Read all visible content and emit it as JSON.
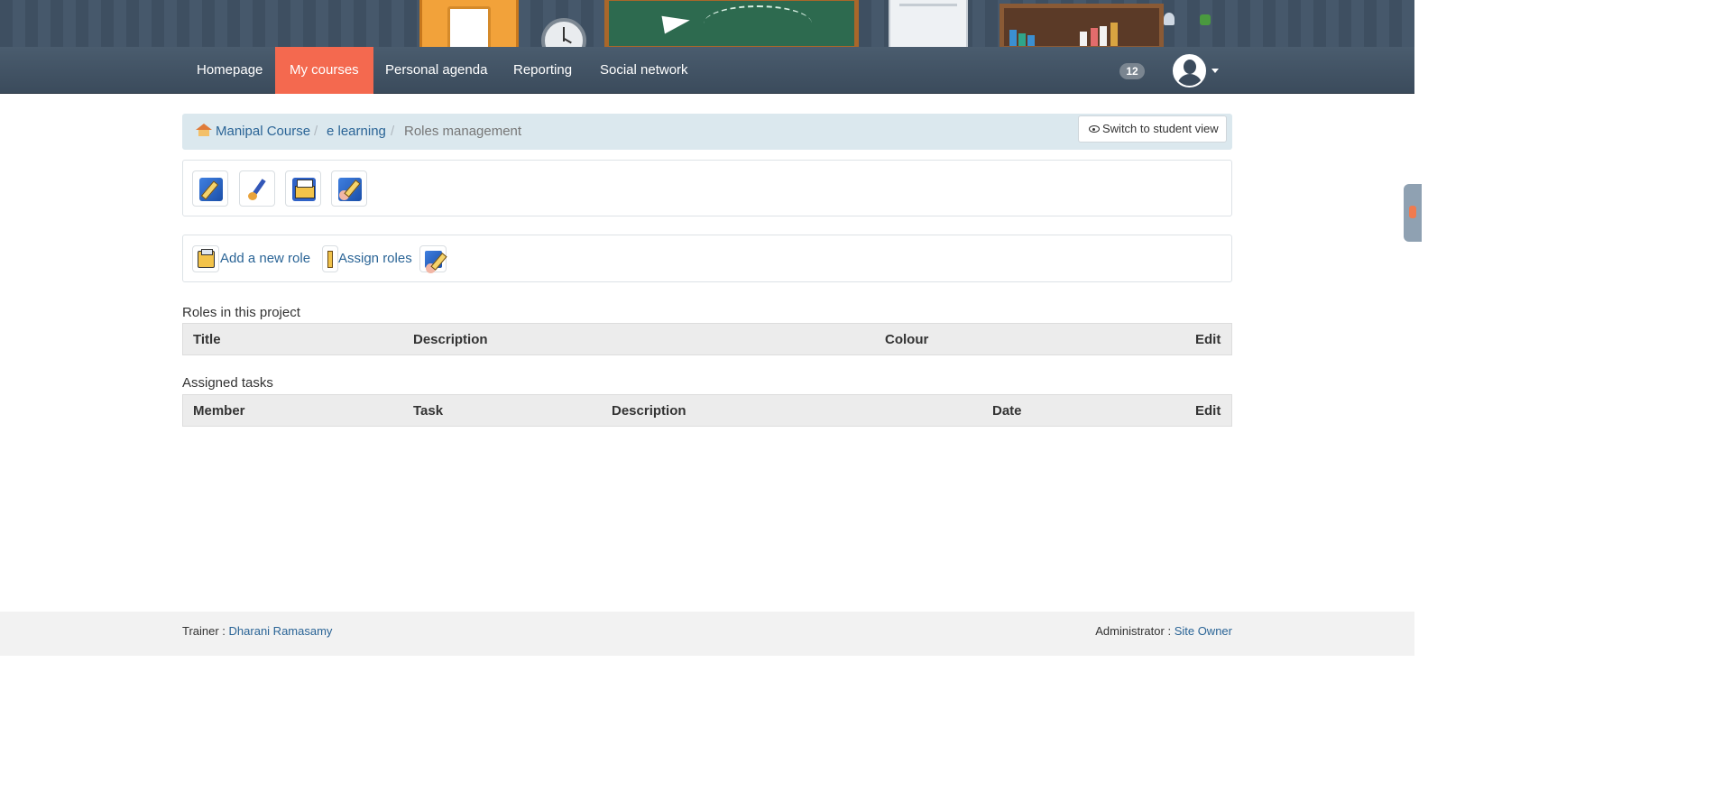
{
  "nav": {
    "items": [
      {
        "label": "Homepage"
      },
      {
        "label": "My courses"
      },
      {
        "label": "Personal agenda"
      },
      {
        "label": "Reporting"
      },
      {
        "label": "Social network"
      }
    ],
    "notification_count": "12"
  },
  "breadcrumb": {
    "items": [
      "Manipal Course",
      "e learning"
    ],
    "current": "Roles management",
    "separator": "/",
    "switch_view": "Switch to student view"
  },
  "actions": {
    "add_role": "Add a new role",
    "assign_roles": "Assign roles"
  },
  "roles_table": {
    "title": "Roles in this project",
    "columns": [
      "Title",
      "Description",
      "Colour",
      "Edit"
    ]
  },
  "tasks_table": {
    "title": "Assigned tasks",
    "columns": [
      "Member",
      "Task",
      "Description",
      "Date",
      "Edit"
    ]
  },
  "footer": {
    "trainer_label": "Trainer :",
    "trainer_name": "Dharani Ramasamy",
    "admin_label": "Administrator :",
    "admin_name": "Site Owner"
  },
  "colors": {
    "active_nav": "#f4694f",
    "link": "#2a6496",
    "breadcrumb_bg": "#dbe8ee",
    "navbar": "#3b4b5c"
  },
  "icons": {
    "toolbar": [
      "edit-icon",
      "brush-icon",
      "typewriter-icon",
      "user-edit-icon"
    ],
    "eye": "eye-icon",
    "home": "home-icon"
  }
}
